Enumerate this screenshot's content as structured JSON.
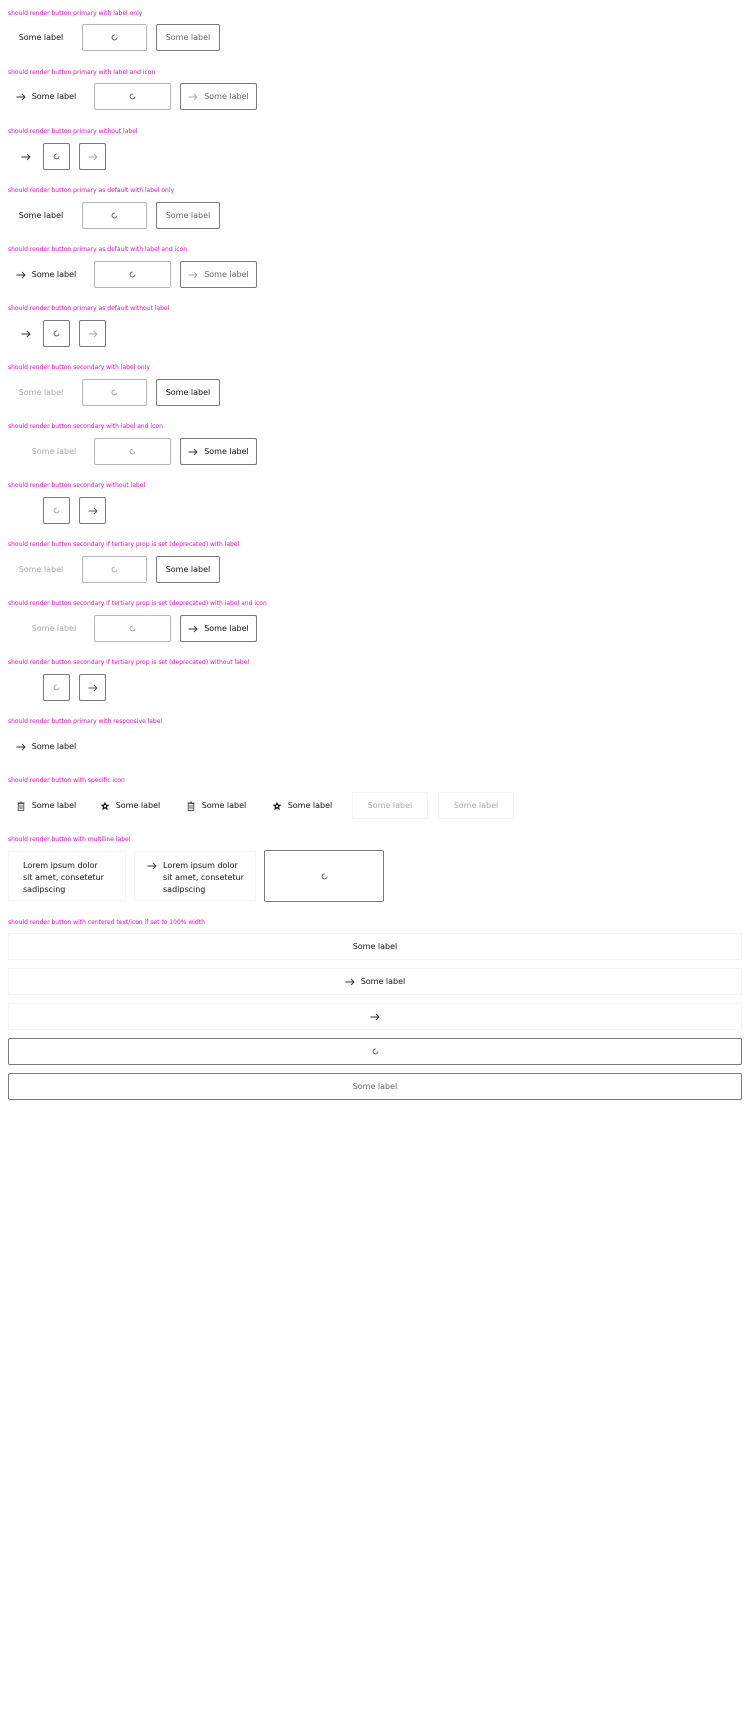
{
  "sections": [
    {
      "id": "s1",
      "title": "should render button primary with label only"
    },
    {
      "id": "s2",
      "title": "should render button primary with label and icon"
    },
    {
      "id": "s3",
      "title": "should render button primary without label"
    },
    {
      "id": "s4",
      "title": "should render button primary as default with label only"
    },
    {
      "id": "s5",
      "title": "should render button primary as default with label and icon"
    },
    {
      "id": "s6",
      "title": "should render button primary as default without label"
    },
    {
      "id": "s7",
      "title": "should render button secondary with label only"
    },
    {
      "id": "s8",
      "title": "should render button secondary with label and icon"
    },
    {
      "id": "s9",
      "title": "should render button secondary without label"
    },
    {
      "id": "s10",
      "title": "should render button secondary if tertiary prop is set (deprecated) with label"
    },
    {
      "id": "s11",
      "title": "should render button secondary if tertiary prop is set (deprecated) with label and icon"
    },
    {
      "id": "s12",
      "title": "should render button secondary if tertiary prop is set (deprecated) without label"
    },
    {
      "id": "s13",
      "title": "should render button primary with responsive label"
    },
    {
      "id": "s14",
      "title": "should render button with specific icon"
    },
    {
      "id": "s15",
      "title": "should render button with multiline label"
    },
    {
      "id": "s16",
      "title": "should render button with centered text/icon if set to 100% width"
    }
  ],
  "labels": {
    "some_label": "Some label",
    "multiline": "Lorem ipsum dolor sit amet, consetetur sadipscing"
  },
  "icons": {
    "arrow": "arrow-right-icon",
    "loading": "loading-spinner-icon",
    "trash": "delete-icon",
    "star": "star-icon"
  },
  "colors": {
    "section_title": "#ff00c8",
    "border": "#7a7a7a",
    "muted_text": "#a9a9a9"
  }
}
